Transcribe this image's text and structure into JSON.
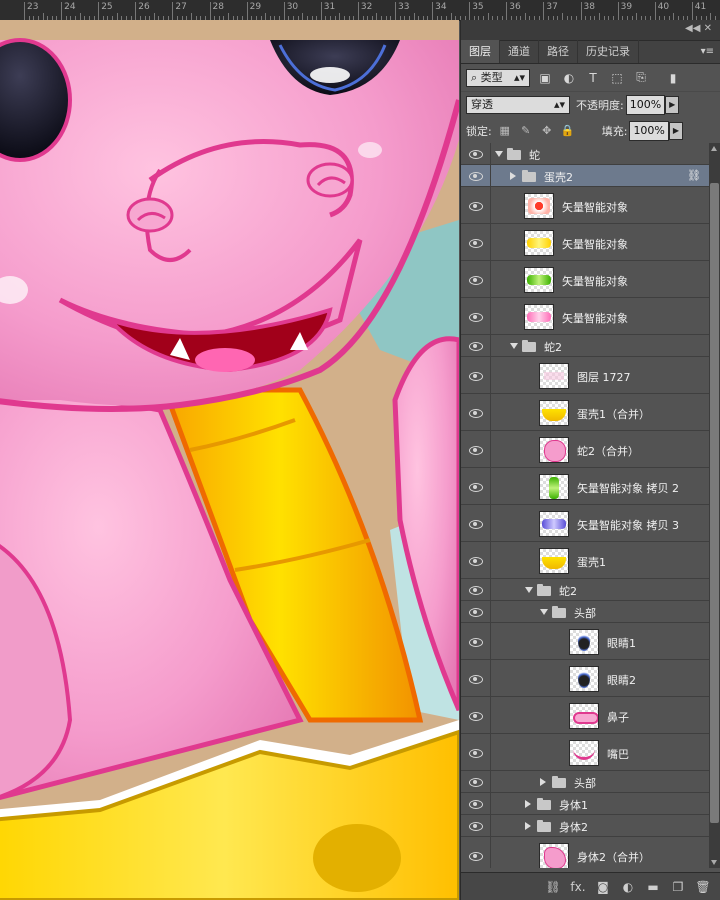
{
  "ruler": {
    "labels": [
      "23",
      "24",
      "25",
      "26",
      "27",
      "28",
      "29",
      "30",
      "31",
      "32",
      "33",
      "34",
      "35",
      "36",
      "37",
      "38",
      "39",
      "40",
      "41"
    ]
  },
  "panel": {
    "tabs": [
      {
        "label": "图层",
        "active": true
      },
      {
        "label": "通道",
        "active": false
      },
      {
        "label": "路径",
        "active": false
      },
      {
        "label": "历史记录",
        "active": false
      }
    ],
    "filter": {
      "kind_label": "类型",
      "search_icon": "search-icon"
    },
    "blend_mode": "穿透",
    "opacity_label": "不透明度:",
    "opacity_value": "100%",
    "lock_label": "锁定:",
    "fill_label": "填充:",
    "fill_value": "100%"
  },
  "layers": [
    {
      "name": "蛇",
      "type": "group",
      "indent": 0,
      "expanded": true,
      "selected": false
    },
    {
      "name": "蛋壳2",
      "type": "group",
      "indent": 1,
      "expanded": false,
      "selected": true,
      "linked": true
    },
    {
      "name": "矢量智能对象",
      "type": "layer",
      "indent": 1,
      "thumb": "candy-red"
    },
    {
      "name": "矢量智能对象",
      "type": "layer",
      "indent": 1,
      "thumb": "candy-yellow"
    },
    {
      "name": "矢量智能对象",
      "type": "layer",
      "indent": 1,
      "thumb": "candy-green"
    },
    {
      "name": "矢量智能对象",
      "type": "layer",
      "indent": 1,
      "thumb": "candy-pink"
    },
    {
      "name": "蛇2",
      "type": "group",
      "indent": 1,
      "expanded": true
    },
    {
      "name": "图层 1727",
      "type": "layer",
      "indent": 2,
      "thumb": "blank-pink"
    },
    {
      "name": "蛋壳1（合并）",
      "type": "layer",
      "indent": 2,
      "thumb": "shell-yellow"
    },
    {
      "name": "蛇2（合并）",
      "type": "layer",
      "indent": 2,
      "thumb": "snake-pink"
    },
    {
      "name": "矢量智能对象 拷贝 2",
      "type": "layer",
      "indent": 2,
      "thumb": "candy-green-v"
    },
    {
      "name": "矢量智能对象 拷贝 3",
      "type": "layer",
      "indent": 2,
      "thumb": "candy-blue"
    },
    {
      "name": "蛋壳1",
      "type": "layer",
      "indent": 2,
      "thumb": "shell-yellow"
    },
    {
      "name": "蛇2",
      "type": "group",
      "indent": 2,
      "expanded": true
    },
    {
      "name": "头部",
      "type": "group",
      "indent": 3,
      "expanded": true
    },
    {
      "name": "眼睛1",
      "type": "layer",
      "indent": 4,
      "thumb": "eye"
    },
    {
      "name": "眼睛2",
      "type": "layer",
      "indent": 4,
      "thumb": "eye"
    },
    {
      "name": "鼻子",
      "type": "layer",
      "indent": 4,
      "thumb": "nose"
    },
    {
      "name": "嘴巴",
      "type": "layer",
      "indent": 4,
      "thumb": "mouth"
    },
    {
      "name": "头部",
      "type": "group",
      "indent": 3,
      "expanded": false
    },
    {
      "name": "身体1",
      "type": "group",
      "indent": 2,
      "expanded": false
    },
    {
      "name": "身体2",
      "type": "group",
      "indent": 2,
      "expanded": false
    },
    {
      "name": "身体2（合并）",
      "type": "layer",
      "indent": 2,
      "thumb": "body-pink"
    }
  ],
  "bottom_icons": [
    "link-icon",
    "fx-icon",
    "mask-icon",
    "adjustment-icon",
    "new-group-icon",
    "new-layer-icon",
    "trash-icon"
  ],
  "bottom_labels": {
    "fx": "fx."
  }
}
